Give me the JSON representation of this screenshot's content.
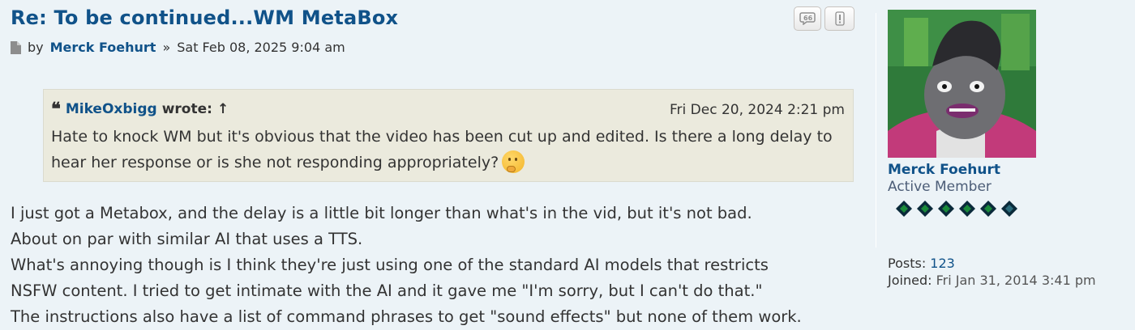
{
  "post": {
    "title": "Re: To be continued...WM MetaBox",
    "by_label": "by",
    "author": "Merck Foehurt",
    "separator": "»",
    "date": "Sat Feb 08, 2025 9:04 am",
    "actions": {
      "quote_icon": "quote-bubble-icon",
      "report_icon": "exclamation-icon"
    }
  },
  "quote": {
    "author": "MikeOxbigg",
    "wrote_label": "wrote:",
    "arrow": "↑",
    "date": "Fri Dec 20, 2024 2:21 pm",
    "text": "Hate to knock WM but it's obvious that the video has been cut up and edited. Is there a long delay to hear her response or is she not responding appropriately?",
    "emoji": "thinking-face-icon"
  },
  "body": {
    "lines": [
      "I just got a Metabox, and the delay is a little bit longer than what's in the vid, but it's not bad.",
      "About on par with similar AI that uses a TTS.",
      "What's annoying though is I think they're just using one of the standard AI models that restricts",
      "NSFW content. I tried to get intimate with the AI and it gave me \"I'm sorry, but I can't do that.\"",
      "The instructions also have a list of command phrases to get \"sound effects\" but none of them work."
    ]
  },
  "profile": {
    "name": "Merck Foehurt",
    "rank": "Active Member",
    "rank_gems": 6,
    "posts_label": "Posts:",
    "posts": "123",
    "joined_label": "Joined:",
    "joined": "Fri Jan 31, 2014 3:41 pm"
  },
  "colors": {
    "link": "#105289",
    "background": "#ecf3f7",
    "quote_bg": "#ebeadd"
  }
}
